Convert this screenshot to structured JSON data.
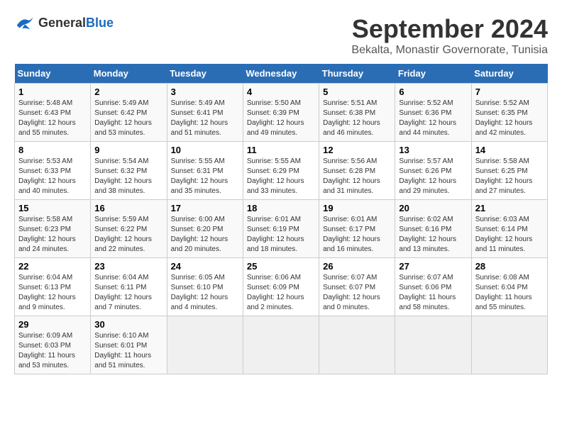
{
  "header": {
    "logo_general": "General",
    "logo_blue": "Blue",
    "title": "September 2024",
    "subtitle": "Bekalta, Monastir Governorate, Tunisia"
  },
  "calendar": {
    "days_of_week": [
      "Sunday",
      "Monday",
      "Tuesday",
      "Wednesday",
      "Thursday",
      "Friday",
      "Saturday"
    ],
    "weeks": [
      [
        {
          "num": "",
          "info": ""
        },
        {
          "num": "2",
          "info": "Sunrise: 5:49 AM\nSunset: 6:42 PM\nDaylight: 12 hours\nand 53 minutes."
        },
        {
          "num": "3",
          "info": "Sunrise: 5:49 AM\nSunset: 6:41 PM\nDaylight: 12 hours\nand 51 minutes."
        },
        {
          "num": "4",
          "info": "Sunrise: 5:50 AM\nSunset: 6:39 PM\nDaylight: 12 hours\nand 49 minutes."
        },
        {
          "num": "5",
          "info": "Sunrise: 5:51 AM\nSunset: 6:38 PM\nDaylight: 12 hours\nand 46 minutes."
        },
        {
          "num": "6",
          "info": "Sunrise: 5:52 AM\nSunset: 6:36 PM\nDaylight: 12 hours\nand 44 minutes."
        },
        {
          "num": "7",
          "info": "Sunrise: 5:52 AM\nSunset: 6:35 PM\nDaylight: 12 hours\nand 42 minutes."
        }
      ],
      [
        {
          "num": "8",
          "info": "Sunrise: 5:53 AM\nSunset: 6:33 PM\nDaylight: 12 hours\nand 40 minutes."
        },
        {
          "num": "9",
          "info": "Sunrise: 5:54 AM\nSunset: 6:32 PM\nDaylight: 12 hours\nand 38 minutes."
        },
        {
          "num": "10",
          "info": "Sunrise: 5:55 AM\nSunset: 6:31 PM\nDaylight: 12 hours\nand 35 minutes."
        },
        {
          "num": "11",
          "info": "Sunrise: 5:55 AM\nSunset: 6:29 PM\nDaylight: 12 hours\nand 33 minutes."
        },
        {
          "num": "12",
          "info": "Sunrise: 5:56 AM\nSunset: 6:28 PM\nDaylight: 12 hours\nand 31 minutes."
        },
        {
          "num": "13",
          "info": "Sunrise: 5:57 AM\nSunset: 6:26 PM\nDaylight: 12 hours\nand 29 minutes."
        },
        {
          "num": "14",
          "info": "Sunrise: 5:58 AM\nSunset: 6:25 PM\nDaylight: 12 hours\nand 27 minutes."
        }
      ],
      [
        {
          "num": "15",
          "info": "Sunrise: 5:58 AM\nSunset: 6:23 PM\nDaylight: 12 hours\nand 24 minutes."
        },
        {
          "num": "16",
          "info": "Sunrise: 5:59 AM\nSunset: 6:22 PM\nDaylight: 12 hours\nand 22 minutes."
        },
        {
          "num": "17",
          "info": "Sunrise: 6:00 AM\nSunset: 6:20 PM\nDaylight: 12 hours\nand 20 minutes."
        },
        {
          "num": "18",
          "info": "Sunrise: 6:01 AM\nSunset: 6:19 PM\nDaylight: 12 hours\nand 18 minutes."
        },
        {
          "num": "19",
          "info": "Sunrise: 6:01 AM\nSunset: 6:17 PM\nDaylight: 12 hours\nand 16 minutes."
        },
        {
          "num": "20",
          "info": "Sunrise: 6:02 AM\nSunset: 6:16 PM\nDaylight: 12 hours\nand 13 minutes."
        },
        {
          "num": "21",
          "info": "Sunrise: 6:03 AM\nSunset: 6:14 PM\nDaylight: 12 hours\nand 11 minutes."
        }
      ],
      [
        {
          "num": "22",
          "info": "Sunrise: 6:04 AM\nSunset: 6:13 PM\nDaylight: 12 hours\nand 9 minutes."
        },
        {
          "num": "23",
          "info": "Sunrise: 6:04 AM\nSunset: 6:11 PM\nDaylight: 12 hours\nand 7 minutes."
        },
        {
          "num": "24",
          "info": "Sunrise: 6:05 AM\nSunset: 6:10 PM\nDaylight: 12 hours\nand 4 minutes."
        },
        {
          "num": "25",
          "info": "Sunrise: 6:06 AM\nSunset: 6:09 PM\nDaylight: 12 hours\nand 2 minutes."
        },
        {
          "num": "26",
          "info": "Sunrise: 6:07 AM\nSunset: 6:07 PM\nDaylight: 12 hours\nand 0 minutes."
        },
        {
          "num": "27",
          "info": "Sunrise: 6:07 AM\nSunset: 6:06 PM\nDaylight: 11 hours\nand 58 minutes."
        },
        {
          "num": "28",
          "info": "Sunrise: 6:08 AM\nSunset: 6:04 PM\nDaylight: 11 hours\nand 55 minutes."
        }
      ],
      [
        {
          "num": "29",
          "info": "Sunrise: 6:09 AM\nSunset: 6:03 PM\nDaylight: 11 hours\nand 53 minutes."
        },
        {
          "num": "30",
          "info": "Sunrise: 6:10 AM\nSunset: 6:01 PM\nDaylight: 11 hours\nand 51 minutes."
        },
        {
          "num": "",
          "info": ""
        },
        {
          "num": "",
          "info": ""
        },
        {
          "num": "",
          "info": ""
        },
        {
          "num": "",
          "info": ""
        },
        {
          "num": "",
          "info": ""
        }
      ]
    ],
    "week0_day1": {
      "num": "1",
      "info": "Sunrise: 5:48 AM\nSunset: 6:43 PM\nDaylight: 12 hours\nand 55 minutes."
    }
  }
}
